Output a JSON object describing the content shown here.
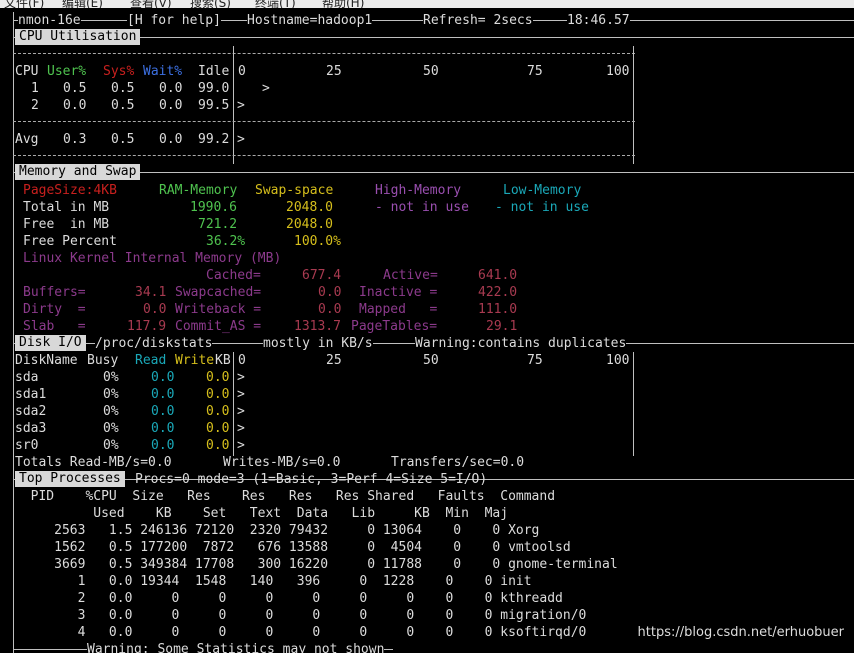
{
  "menubar": {
    "items": [
      "文件(F)",
      "编辑(E)",
      "查看(V)",
      "搜索(S)",
      "终端(T)",
      "帮助(H)"
    ]
  },
  "header": {
    "app": "nmon-16e",
    "help": "[H for help]",
    "hostname": "Hostname=hadoop1",
    "refresh": "Refresh= 2secs",
    "time": "18:46.57"
  },
  "cpu": {
    "title": "CPU Utilisation",
    "cols": {
      "cpu": "CPU",
      "user": "User%",
      "sys": "Sys%",
      "wait": "Wait%",
      "idle": "Idle"
    },
    "scale": [
      "0",
      "25",
      "50",
      "75",
      "100"
    ],
    "rows": [
      {
        "id": "1",
        "user": "0.5",
        "sys": "0.5",
        "wait": "0.0",
        "idle": "99.0",
        "bar": ">"
      },
      {
        "id": "2",
        "user": "0.0",
        "sys": "0.5",
        "wait": "0.0",
        "idle": "99.5",
        "bar": ">"
      }
    ],
    "avg": {
      "label": "Avg",
      "user": "0.3",
      "sys": "0.5",
      "wait": "0.0",
      "idle": "99.2",
      "bar": ">"
    }
  },
  "memory": {
    "title": "Memory and Swap",
    "hdr": {
      "pagesize": "PageSize:4KB",
      "ram": "RAM-Memory",
      "swap": "Swap-space",
      "high": "High-Memory",
      "low": "Low-Memory"
    },
    "total": {
      "label": "Total in MB",
      "ram": "1990.6",
      "swap": "2048.0",
      "high": "- not in use",
      "low": "- not in use"
    },
    "free": {
      "label": "Free  in MB",
      "ram": "721.2",
      "swap": "2048.0"
    },
    "pct": {
      "label": "Free Percent",
      "ram": "36.2%",
      "swap": "100.0%"
    },
    "kernel_title": "Linux Kernel Internal Memory (MB)",
    "cached": {
      "label": "Cached=",
      "value": "677.4"
    },
    "active": {
      "label": "Active=",
      "value": "641.0"
    },
    "buffers": {
      "label": "Buffers=",
      "value": "34.1"
    },
    "swapcached": {
      "label": "Swapcached=",
      "value": "0.0"
    },
    "inactive": {
      "label": "Inactive =",
      "value": "422.0"
    },
    "dirty": {
      "label": "Dirty  =",
      "value": "0.0"
    },
    "writeback": {
      "label": "Writeback =",
      "value": "0.0"
    },
    "mapped": {
      "label": "Mapped   =",
      "value": "111.0"
    },
    "slab": {
      "label": "Slab   =",
      "value": "117.9"
    },
    "commit": {
      "label": "Commit_AS =",
      "value": "1313.7"
    },
    "pagetables": {
      "label": "PageTables=",
      "value": "29.1"
    }
  },
  "disk": {
    "title": "Disk I/O",
    "subtitle": "/proc/diskstats",
    "note": "mostly in KB/s",
    "warning": "Warning:contains duplicates",
    "cols": {
      "name": "DiskName",
      "busy": "Busy",
      "read": "Read",
      "write": "Write",
      "kb": "KB"
    },
    "scale": [
      "0",
      "25",
      "50",
      "75",
      "100"
    ],
    "rows": [
      {
        "name": "sda",
        "busy": "0%",
        "read": "0.0",
        "write": "0.0",
        "bar": ">"
      },
      {
        "name": "sda1",
        "busy": "0%",
        "read": "0.0",
        "write": "0.0",
        "bar": ">"
      },
      {
        "name": "sda2",
        "busy": "0%",
        "read": "0.0",
        "write": "0.0",
        "bar": ">"
      },
      {
        "name": "sda3",
        "busy": "0%",
        "read": "0.0",
        "write": "0.0",
        "bar": ">"
      },
      {
        "name": "sr0",
        "busy": "0%",
        "read": "0.0",
        "write": "0.0",
        "bar": ">"
      }
    ],
    "totals": {
      "read": "Totals Read-MB/s=0.0",
      "write": "Writes-MB/s=0.0",
      "transfers": "Transfers/sec=0.0"
    }
  },
  "top": {
    "title": "Top Processes",
    "info": "Procs=0 mode=3 (1=Basic, 3=Perf 4=Size 5=I/O)",
    "hdr1": "  PID    %CPU  Size   Res    Res   Res   Res Shared   Faults  Command",
    "hdr2": "          Used    KB    Set   Text  Data   Lib     KB  Min  Maj",
    "rows": [
      "     2563   1.5 246136 72120  2320 79432     0 13064    0    0 Xorg",
      "     1562   0.5 177200  7872   676 13588     0  4504    0    0 vmtoolsd",
      "     3669   0.5 349384 17708   300 16220     0 11788    0    0 gnome-terminal",
      "        1   0.0 19344  1548   140   396     0  1228    0    0 init",
      "        2   0.0     0     0     0     0     0     0    0    0 kthreadd",
      "        3   0.0     0     0     0     0     0     0    0    0 migration/0",
      "        4   0.0     0     0     0     0     0     0    0    0 ksoftirqd/0"
    ],
    "warning": "Warning: Some Statistics may not shown"
  },
  "watermark": "https://blog.csdn.net/erhuobuer"
}
